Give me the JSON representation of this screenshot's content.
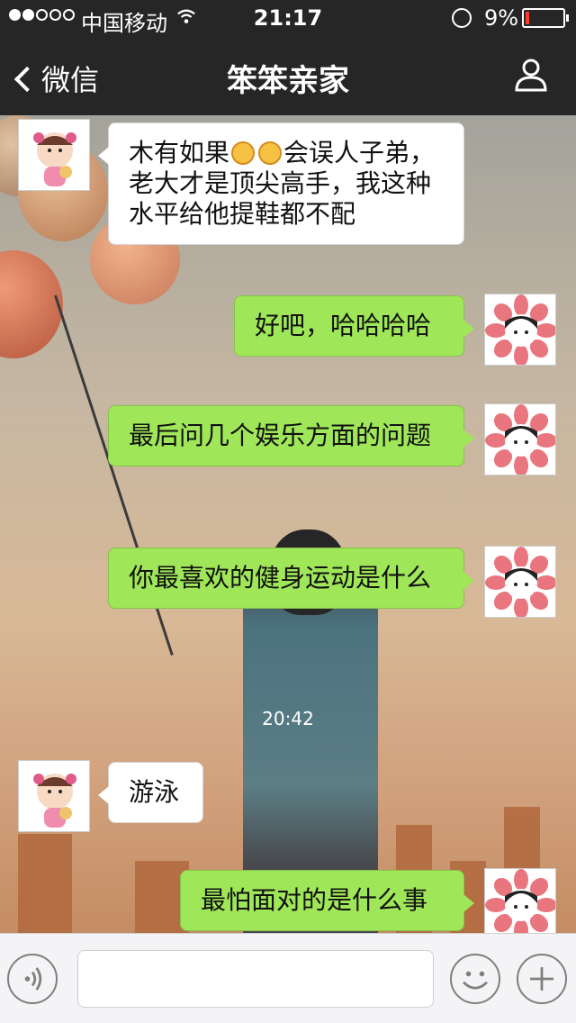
{
  "status_bar": {
    "carrier": "中国移动",
    "time": "21:17",
    "battery_percent": "9%",
    "battery_level": 0.09
  },
  "nav": {
    "back_label": "微信",
    "title": "笨笨亲家"
  },
  "messages": [
    {
      "side": "left",
      "text_before": "木有如果",
      "text_after": "会误人子弟，老大才是顶尖高手，我这种水平给他提鞋都不配",
      "emoji_count": 2
    },
    {
      "side": "right",
      "text": "好吧，哈哈哈哈"
    },
    {
      "side": "right",
      "text": "最后问几个娱乐方面的问题"
    },
    {
      "side": "right",
      "text": "你最喜欢的健身运动是什么"
    },
    {
      "side": "left",
      "text": "游泳"
    },
    {
      "side": "right",
      "text": "最怕面对的是什么事"
    }
  ],
  "timestamp": "20:42",
  "icons": {
    "back": "chevron-left-icon",
    "profile": "person-icon",
    "voice": "voice-icon",
    "emoji": "smiley-icon",
    "plus": "plus-icon"
  },
  "colors": {
    "nav_bg": "#262626",
    "sent_bubble": "#9fe658",
    "received_bubble": "#ffffff",
    "battery_low": "#ff3b30"
  }
}
